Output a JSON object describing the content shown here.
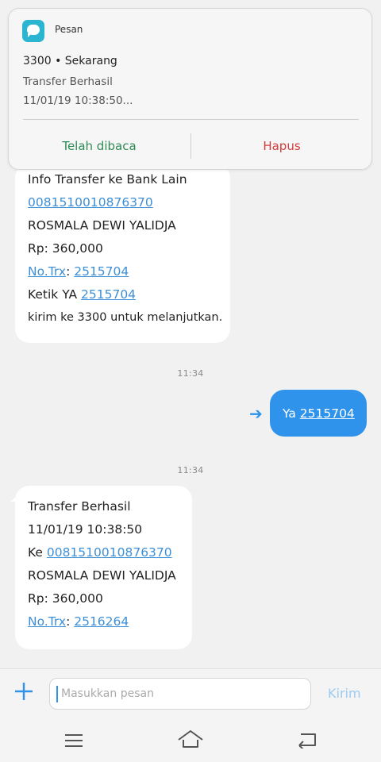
{
  "notification": {
    "app_name": "Pesan",
    "sender": "3300 • Sekarang",
    "line1": "Transfer Berhasil",
    "line2": "11/01/19 10:38:50...",
    "read_label": "Telah dibaca",
    "delete_label": "Hapus"
  },
  "messages": {
    "first": {
      "l1": "Info Transfer ke Bank Lain",
      "account": "0081510010876370",
      "name": "ROSMALA DEWI YALIDJA",
      "amount": "Rp: 360,000",
      "trx_label": "No.Trx",
      "trx_sep": ": ",
      "trx_num": "2515704",
      "reply_prefix": "Ketik YA ",
      "reply_code": "2515704",
      "l7": "kirim ke 3300 untuk melanjutkan."
    },
    "time1": "11:34",
    "sent": {
      "prefix": "Ya ",
      "code": "2515704"
    },
    "time2": "11:34",
    "second": {
      "l1": "Transfer Berhasil",
      "l2": "11/01/19 10:38:50",
      "ke_prefix": "Ke ",
      "account": "0081510010876370",
      "name": "ROSMALA DEWI YALIDJA",
      "amount": "Rp: 360,000",
      "trx_label": "No.Trx",
      "trx_sep": ": ",
      "trx_num": "2516264"
    }
  },
  "composer": {
    "placeholder": "Masukkan pesan",
    "send_label": "Kirim"
  },
  "colors": {
    "accent": "#2f93ec",
    "link": "#3d8fd6",
    "read_button": "#2e8a55",
    "delete_button": "#d23c3c"
  },
  "icons": [
    "message-app-icon",
    "sent-arrow-icon",
    "plus-icon",
    "menu-icon",
    "home-icon",
    "back-icon"
  ]
}
